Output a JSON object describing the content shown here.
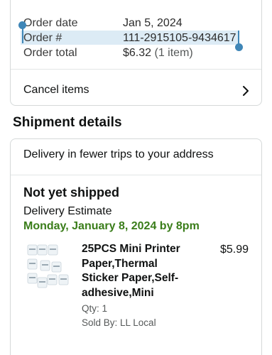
{
  "order": {
    "date_label": "Order date",
    "date_value": "Jan 5, 2024",
    "number_label": "Order #",
    "number_value": "111-2915105-9434617",
    "total_label": "Order total",
    "total_value": "$6.32",
    "total_items": "(1 item)"
  },
  "cancel": {
    "label": "Cancel items"
  },
  "shipment": {
    "title": "Shipment details",
    "delivery_note": "Delivery in fewer trips to your address",
    "status": "Not yet shipped",
    "estimate_label": "Delivery Estimate",
    "estimate_value": "Monday, January 8, 2024 by 8pm"
  },
  "item": {
    "name": "25PCS Mini Printer Paper,Thermal Sticker Paper,Self-adhesive,Mini",
    "price": "$5.99",
    "qty": "Qty: 1",
    "seller": "Sold By: LL Local",
    "image_icon": "thermal-paper-rolls-thumbnail"
  },
  "colors": {
    "selection": "#dcebf5",
    "handle": "#3f86b7",
    "estimate_green": "#3a7d1a"
  }
}
